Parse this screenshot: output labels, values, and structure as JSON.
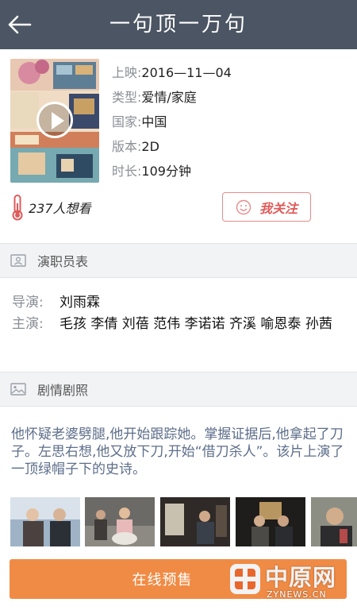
{
  "header": {
    "title": "一句顶一万句",
    "back_icon": "back-arrow-icon"
  },
  "movie": {
    "facts": [
      {
        "key": "上映:",
        "value": "2016—11—04"
      },
      {
        "key": "类型:",
        "value": "爱情/家庭"
      },
      {
        "key": "国家:",
        "value": "中国"
      },
      {
        "key": "版本:",
        "value": "2D"
      },
      {
        "key": "时长:",
        "value": "109分钟"
      }
    ],
    "want_count": "237人想看",
    "follow_label": "我关注"
  },
  "cast_section": {
    "title": "演职员表",
    "director_label": "导演:",
    "director": "刘雨霖",
    "stars_label": "主演:",
    "stars": "毛孩 李倩 刘蓓 范伟 李诺诺 齐溪 喻恩泰 孙茜"
  },
  "plot_section": {
    "title": "剧情剧照",
    "synopsis": "他怀疑老婆劈腿,他开始跟踪她。掌握证据后,他拿起了刀子。左思右想,他又放下刀,开始“借刀杀人”。该片上演了一顶绿帽子下的史诗。"
  },
  "buy": {
    "label": "在线预售"
  },
  "watermark": {
    "name": "中原网",
    "url": "ZYNEWS.CN"
  },
  "colors": {
    "header_bg": "#4b5563",
    "accent_orange": "#f08b45",
    "follow_red": "#e05a5a",
    "synopsis_text": "#5d6e8a"
  }
}
